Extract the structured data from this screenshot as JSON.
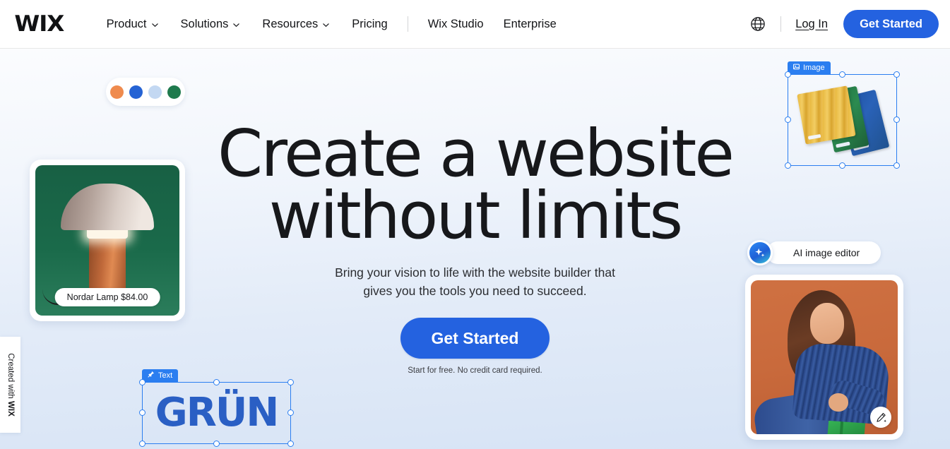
{
  "brand": {
    "logo_text": "WIX",
    "accent_blue": "#2462e0",
    "selection_blue": "#2b7ef0"
  },
  "nav": {
    "items": [
      {
        "label": "Product",
        "has_dropdown": true
      },
      {
        "label": "Solutions",
        "has_dropdown": true
      },
      {
        "label": "Resources",
        "has_dropdown": true
      },
      {
        "label": "Pricing",
        "has_dropdown": false
      }
    ],
    "secondary_items": [
      {
        "label": "Wix Studio"
      },
      {
        "label": "Enterprise"
      }
    ],
    "language_icon": "globe-icon",
    "login_label": "Log In",
    "get_started_label": "Get Started"
  },
  "hero": {
    "headline_line1": "Create a website",
    "headline_line2": "without limits",
    "subheadline_line1": "Bring your vision to life with the website builder that",
    "subheadline_line2": "gives you the tools you need to succeed.",
    "cta_label": "Get Started",
    "cta_note": "Start for free. No credit card required."
  },
  "swatches": {
    "colors": [
      "#ef8b4e",
      "#2563d4",
      "#c3d8f2",
      "#1f7a4d"
    ]
  },
  "product_card": {
    "label": "Nordar Lamp $84.00",
    "image_alt": "mushroom table lamp on green background"
  },
  "wix_badge": {
    "prefix": "Created with ",
    "brand": "WIX"
  },
  "image_selection": {
    "label": "Image",
    "label_icon": "image-icon",
    "alt": "stack of notebooks"
  },
  "text_selection": {
    "label": "Text",
    "label_icon": "pin-icon",
    "content": "GRÜN"
  },
  "ai_tool": {
    "badge_icon": "sparkle-icon",
    "label": "AI image editor"
  },
  "photo_card": {
    "alt": "woman in blue sweater sitting on green chair",
    "edit_icon": "pencil-sparkle-icon"
  }
}
